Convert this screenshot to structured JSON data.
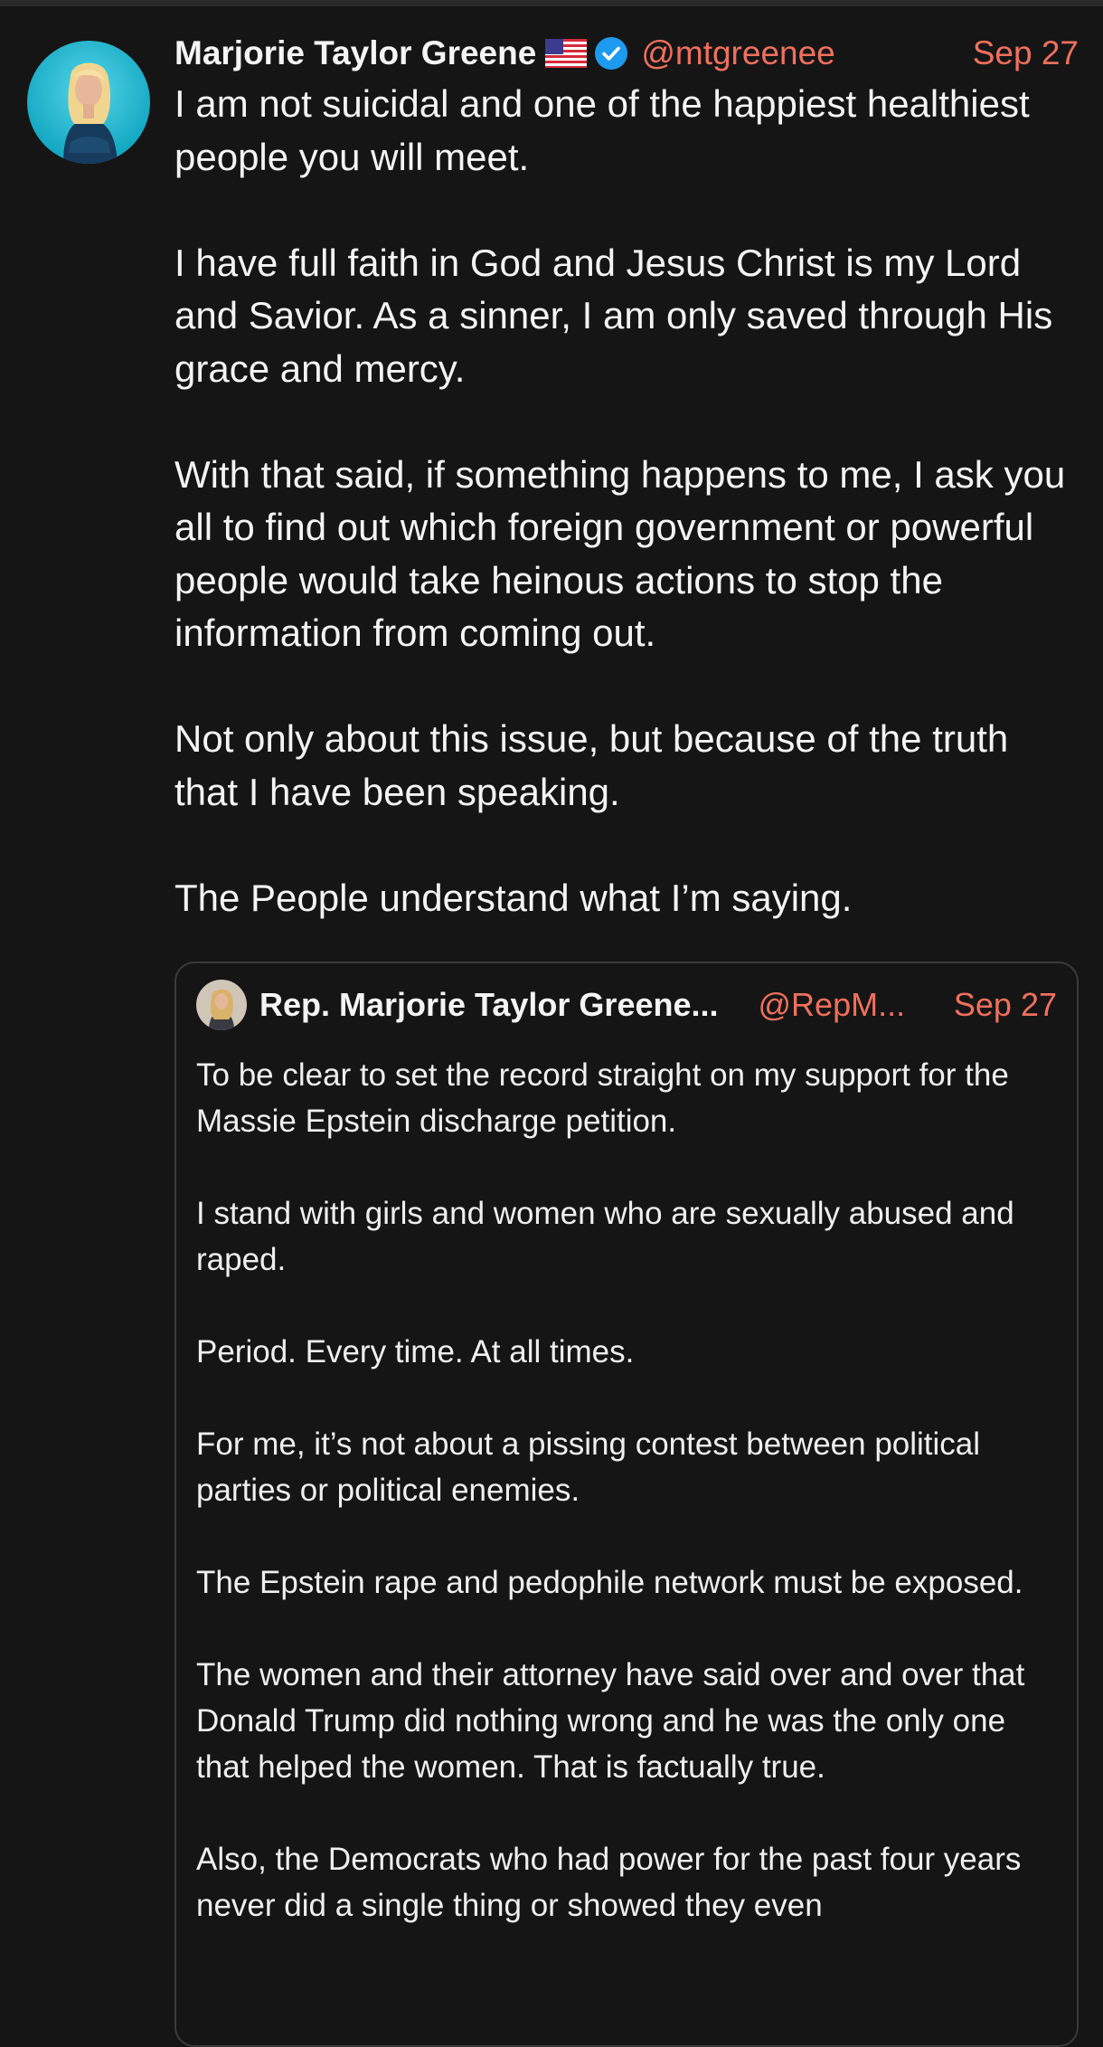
{
  "post": {
    "author_name": "Marjorie Taylor Greene",
    "flag_emoji": "🇺🇸",
    "handle": "@mtgreenee",
    "date": "Sep 27",
    "paragraphs": [
      "I am not suicidal and one of the happiest healthiest people you will meet.",
      "I have full faith in God and Jesus Christ is my Lord and Savior. As a sinner, I am only saved through His grace and mercy.",
      "With that said, if something happens to me, I ask you all to find out which foreign government or powerful people would take heinous actions to stop the information from coming out.",
      "Not only about this issue, but because of the truth that I have been speaking.",
      "The People understand what I’m saying."
    ]
  },
  "quoted_post": {
    "author_name": "Rep. Marjorie Taylor Greene...",
    "handle": "@RepM...",
    "date": "Sep 27",
    "paragraphs": [
      "To be clear to set the record straight on my support for the Massie Epstein discharge petition.",
      "I stand with girls and women who are sexually abused and raped.",
      "Period. Every time. At all times.",
      "For me, it’s not about a pissing contest between political parties or political enemies.",
      "The Epstein rape and pedophile network must be exposed.",
      "The women and their attorney have said over and over that Donald Trump did nothing wrong and he was the only one that helped the women. That is factually true.",
      "Also, the Democrats who had power for the past four years never did a single thing or showed they even"
    ]
  },
  "colors": {
    "background": "#151515",
    "accent": "#f0705d",
    "verified_badge": "#1d9bf0",
    "text": "#f4f4f4"
  },
  "icons": {
    "verified": "verified-badge-icon",
    "flag": "us-flag-icon"
  }
}
